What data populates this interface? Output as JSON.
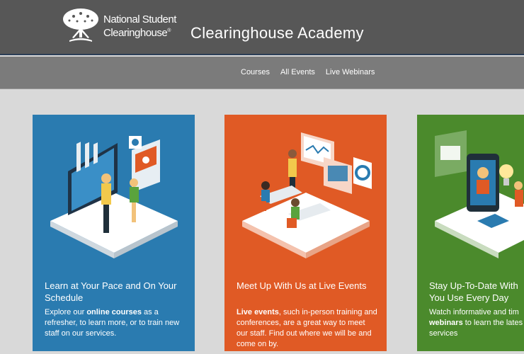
{
  "header": {
    "logo_line1": "National Student",
    "logo_line2": "Clearinghouse",
    "logo_mark": "®",
    "site_title": "Clearinghouse Academy"
  },
  "nav": {
    "items": [
      "Courses",
      "All Events",
      "Live Webinars"
    ]
  },
  "cards": [
    {
      "title": "Learn at Your Pace and On Your Schedule",
      "desc_pre": "Explore our ",
      "desc_bold": "online courses",
      "desc_post": " as a refresher, to learn more, or to train new staff on our services.",
      "color": "#2a7bb0"
    },
    {
      "title": "Meet Up With Us at Live Events",
      "desc_pre": "",
      "desc_bold": "Live events",
      "desc_post": ", such in-person training and conferences, are a great way to meet our staff. Find out where we will be and come on by.",
      "color": "#e05a25"
    },
    {
      "title_line1": "Stay Up-To-Date With",
      "title_line2": "You Use Every Day",
      "desc_line1": "Watch informative and tim",
      "desc_bold": "webinars",
      "desc_post": " to learn the lates",
      "desc_line3": "services",
      "color": "#4b8a2c"
    }
  ]
}
